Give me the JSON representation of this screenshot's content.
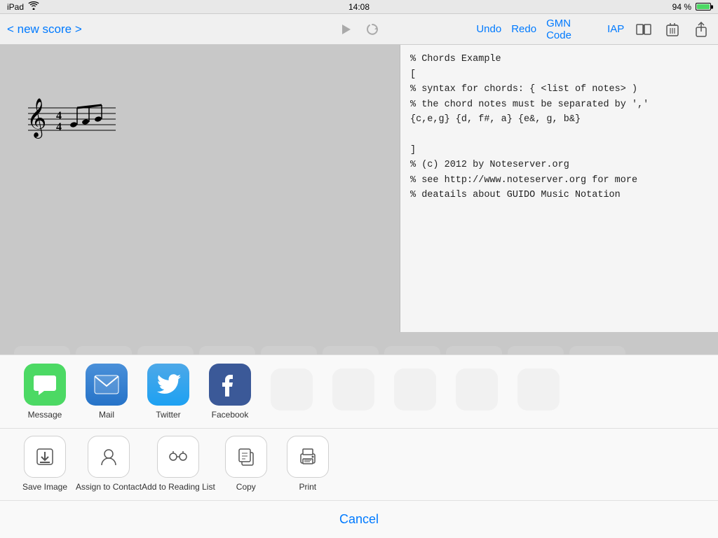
{
  "statusBar": {
    "device": "iPad",
    "wifi": "wifi",
    "time": "14:08",
    "battery": "94 %"
  },
  "toolbar": {
    "back": "< new score >",
    "undo": "Undo",
    "redo": "Redo",
    "gmnCode": "GMN Code",
    "iap": "IAP"
  },
  "code": {
    "content": "% Chords Example\n[\n% syntax for chords: { <list of notes> )\n% the chord notes must be separated by ','\n{c,e,g} {d, f#, a} {e&, g, b&}\n\n]\n% (c) 2012 by Noteserver.org\n% see http://www.noteserver.org for more\n% deatails about GUIDO Music Notation"
  },
  "shareSheet": {
    "appIcons": [
      {
        "id": "message",
        "label": "Message",
        "iconType": "message"
      },
      {
        "id": "mail",
        "label": "Mail",
        "iconType": "mail"
      },
      {
        "id": "twitter",
        "label": "Twitter",
        "iconType": "twitter"
      },
      {
        "id": "facebook",
        "label": "Facebook",
        "iconType": "facebook"
      }
    ],
    "actionIcons": [
      {
        "id": "save-image",
        "label": "Save Image",
        "symbol": "⬇"
      },
      {
        "id": "assign-contact",
        "label": "Assign to\nContact",
        "symbol": "👤"
      },
      {
        "id": "reading-list",
        "label": "Add to Reading\nList",
        "symbol": "👓"
      },
      {
        "id": "copy",
        "label": "Copy",
        "symbol": "📋"
      },
      {
        "id": "print",
        "label": "Print",
        "symbol": "🖨"
      }
    ],
    "cancel": "Cancel"
  }
}
